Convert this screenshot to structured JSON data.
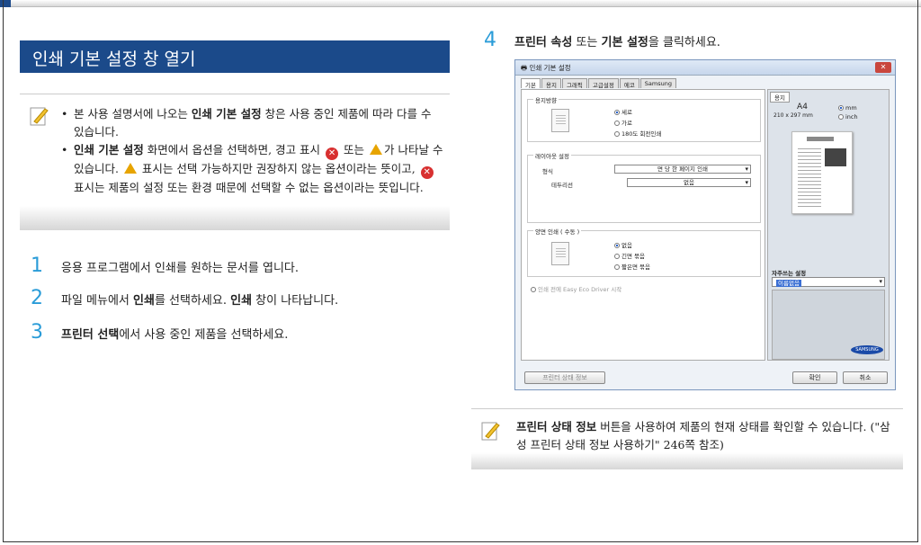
{
  "section": {
    "title": "인쇄 기본 설정 창 열기"
  },
  "note": {
    "item1": {
      "text1": "본 사용 설명서에 나오는 ",
      "bold1": "인쇄 기본 설정",
      "text2": " 창은 사용 중인 제품에 따라 다를 수 있습니다."
    },
    "item2": {
      "bold1": "인쇄 기본 설정",
      "text1": " 화면에서 옵션을 선택하면, 경고 표시 ",
      "text2": " 또는 ",
      "text3": "가 나타날 수 있습니다. ",
      "text4": " 표시는 선택 가능하지만 권장하지 않는 옵션이라는 뜻이고, ",
      "text5": " 표시는 제품의 설정 또는 환경 때문에 선택할 수 없는 옵션이라는 뜻입니다."
    }
  },
  "steps": [
    {
      "num": "1",
      "text": "응용 프로그램에서 인쇄를 원하는 문서를 엽니다."
    },
    {
      "num": "2",
      "text1": "파일 메뉴에서 ",
      "bold1": "인쇄",
      "text2": "를 선택하세요. ",
      "bold2": "인쇄",
      "text3": " 창이 나타납니다."
    },
    {
      "num": "3",
      "bold1": "프린터 선택",
      "text1": "에서 사용 중인 제품을 선택하세요."
    },
    {
      "num": "4",
      "bold1": "프린터 속성",
      "text1": " 또는 ",
      "bold2": "기본 설정",
      "text2": "을 클릭하세요."
    }
  ],
  "dialog": {
    "title": "인쇄 기본 설정",
    "close": "✕",
    "tabs": [
      "기본",
      "용지",
      "그래픽",
      "고급설정",
      "에코",
      "Samsung"
    ],
    "orientation": {
      "label": "용지방향",
      "portrait": "세로",
      "landscape": "가로",
      "rotate": "180도 회전인쇄"
    },
    "layout": {
      "label": "레이아웃 설정",
      "type_label": "형식",
      "type_value": "면 당 한 페이지 인쇄",
      "border_label": "테두리선",
      "border_value": "없음"
    },
    "duplex": {
      "label": "양면 인쇄 ( 수동 )",
      "none": "없음",
      "long": "긴면 묶음",
      "short": "짧은면 묶음"
    },
    "eco_checkbox": "인쇄 전에 Easy Eco Driver 시작",
    "preview": {
      "tab": "용지",
      "size": "A4",
      "dims": "210 x 297 mm",
      "mm": "mm",
      "inch": "inch"
    },
    "favorites": {
      "label": "자주쓰는 설정",
      "value": "이름없음"
    },
    "samsung_logo": "SAMSUNG",
    "status_button": "프린터 상태 정보",
    "ok_button": "확인",
    "cancel_button": "취소"
  },
  "info": {
    "bold1": "프린터 상태 정보",
    "text1": " 버튼을 사용하여 제품의 현재 상태를 확인할 수 있습니다. (\"삼성 프린터 상태 정보 사용하기\" 246쪽 참조)"
  },
  "colors": {
    "title_bg": "#1b4a8a",
    "step_number": "#2a9cd8"
  }
}
